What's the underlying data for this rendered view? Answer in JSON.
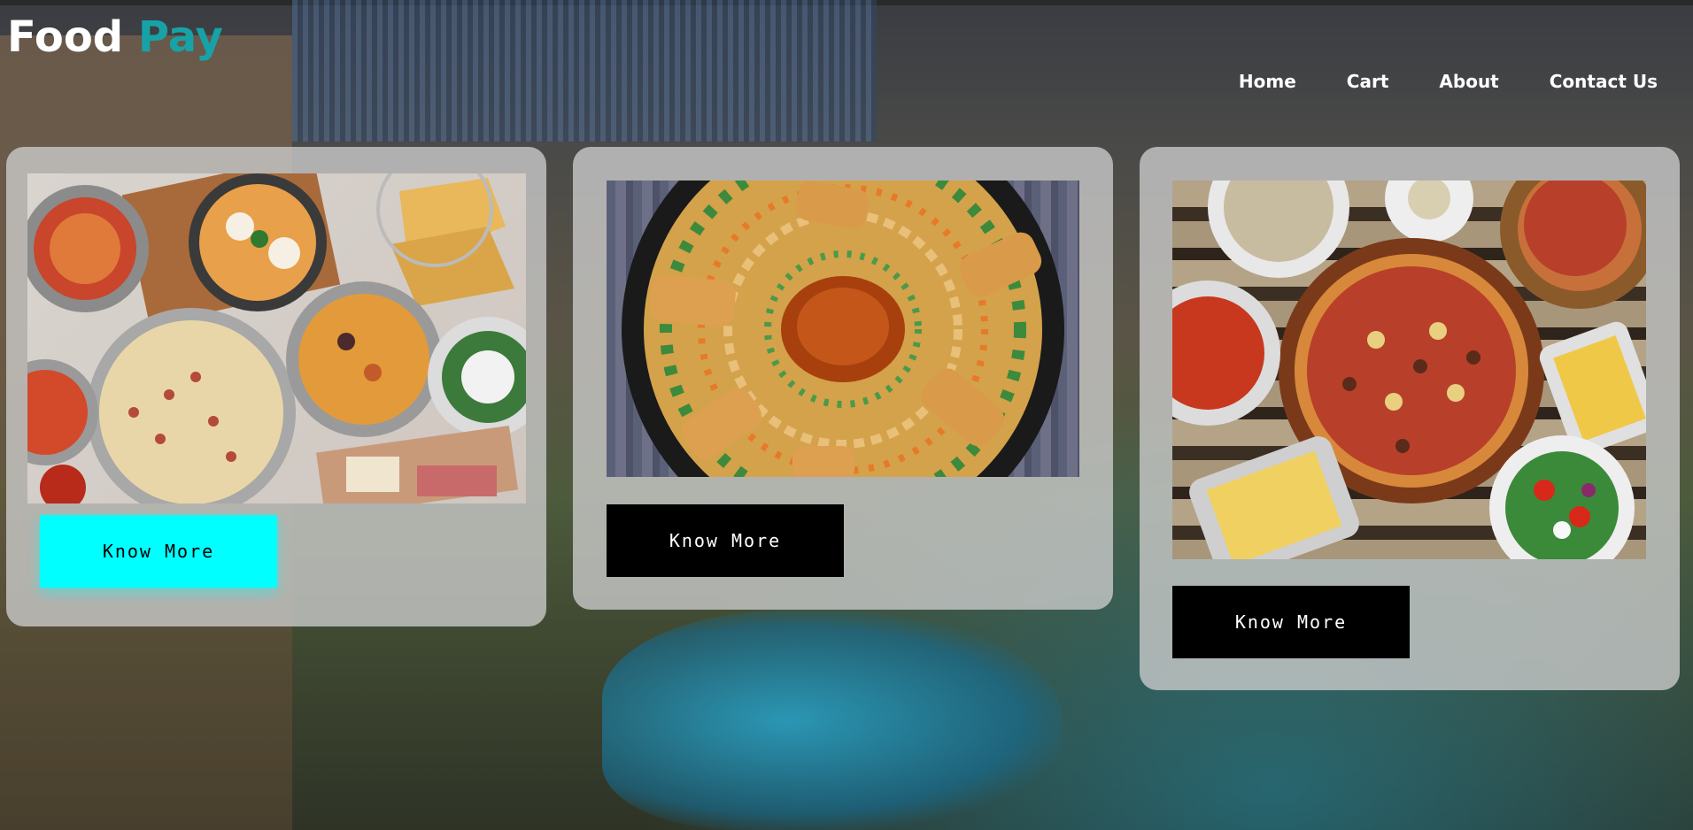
{
  "brand": {
    "part1": "Food",
    "part2": "Pay",
    "accent_color": "#17a2a7"
  },
  "nav": {
    "items": [
      {
        "label": "Home"
      },
      {
        "label": "Cart"
      },
      {
        "label": "About"
      },
      {
        "label": "Contact Us"
      }
    ]
  },
  "cards": [
    {
      "image_icon": "food-spread-image",
      "button_label": "Know More",
      "button_style": "cyan",
      "button_color": "#00ffff"
    },
    {
      "image_icon": "noodle-platter-image",
      "button_label": "Know More",
      "button_style": "dark",
      "button_color": "#000000"
    },
    {
      "image_icon": "pizza-table-image",
      "button_label": "Know More",
      "button_style": "dark",
      "button_color": "#000000"
    }
  ]
}
